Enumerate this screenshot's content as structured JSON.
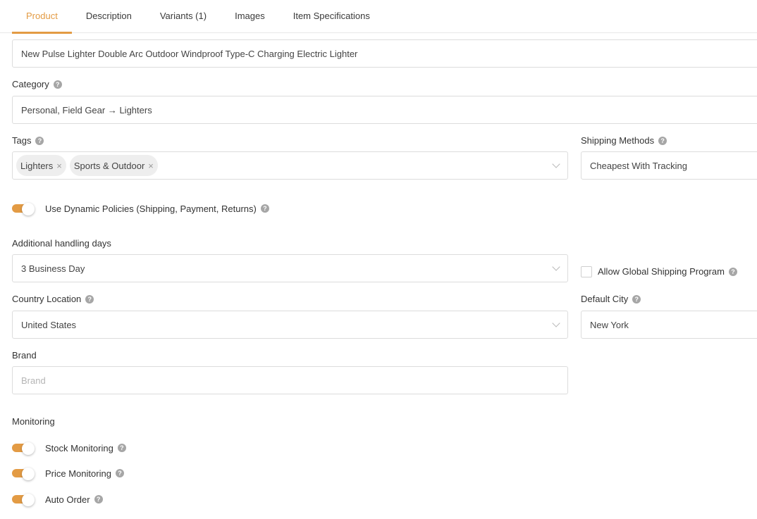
{
  "tabs": [
    {
      "label": "Product",
      "active": true
    },
    {
      "label": "Description",
      "active": false
    },
    {
      "label": "Variants (1)",
      "active": false
    },
    {
      "label": "Images",
      "active": false
    },
    {
      "label": "Item Specifications",
      "active": false
    }
  ],
  "accent_color": "#e39b44",
  "title_field": {
    "value": "New Pulse Lighter Double Arc Outdoor Windproof Type-C Charging Electric Lighter"
  },
  "category": {
    "label": "Category",
    "value": "Personal, Field Gear → Lighters",
    "help_icon": "question-circle-icon"
  },
  "tags": {
    "label": "Tags",
    "items": [
      "Lighters",
      "Sports & Outdoor"
    ],
    "remove_glyph": "×",
    "help_icon": "question-circle-icon"
  },
  "shipping_methods": {
    "label": "Shipping Methods",
    "value": "Cheapest With Tracking",
    "help_icon": "question-circle-icon"
  },
  "dynamic_policies": {
    "label": "Use Dynamic Policies (Shipping, Payment, Returns)",
    "enabled": true
  },
  "handling_days": {
    "label": "Additional handling days",
    "value": "3 Business Day"
  },
  "global_shipping": {
    "label": "Allow Global Shipping Program",
    "checked": false
  },
  "country_location": {
    "label": "Country Location",
    "value": "United States"
  },
  "default_city": {
    "label": "Default City",
    "value": "New York"
  },
  "brand": {
    "label": "Brand",
    "value": "",
    "placeholder": "Brand"
  },
  "monitoring": {
    "label": "Monitoring",
    "items": [
      {
        "label": "Stock Monitoring",
        "enabled": true
      },
      {
        "label": "Price Monitoring",
        "enabled": true
      },
      {
        "label": "Auto Order",
        "enabled": true
      }
    ]
  },
  "help_glyph": "?"
}
